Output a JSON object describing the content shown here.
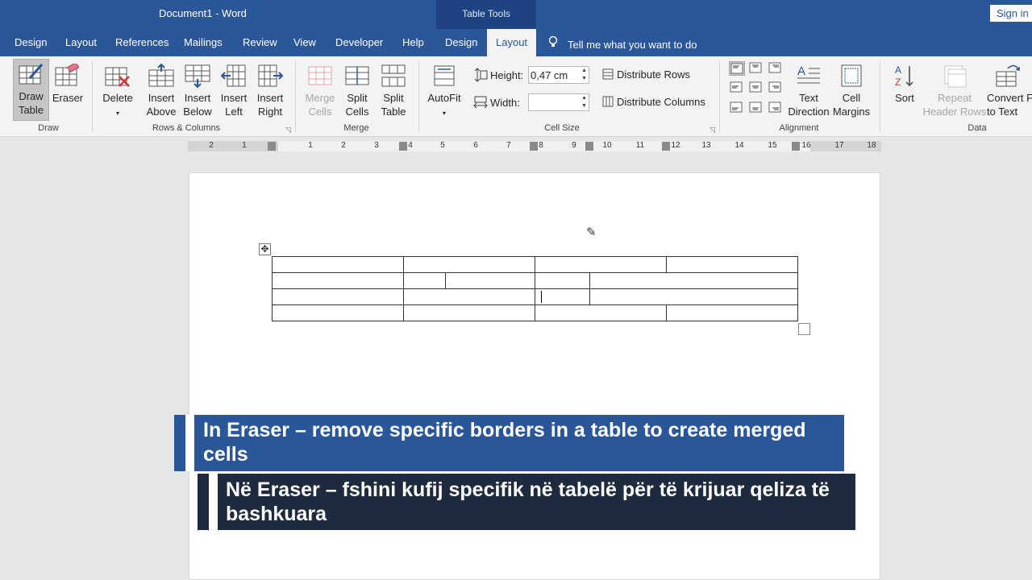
{
  "app": {
    "title": "Document1  -  Word",
    "context_group": "Table Tools",
    "signin": "Sign in"
  },
  "tabs": [
    "Design",
    "Layout",
    "References",
    "Mailings",
    "Review",
    "View",
    "Developer",
    "Help",
    "Design",
    "Layout"
  ],
  "tell_me": "Tell me what you want to do",
  "ribbon": {
    "draw": {
      "label": "Draw",
      "draw_table_l1": "Draw",
      "draw_table_l2": "Table",
      "eraser": "Eraser"
    },
    "rows_columns": {
      "label": "Rows & Columns",
      "delete": "Delete",
      "insert_above_l1": "Insert",
      "insert_above_l2": "Above",
      "insert_below_l1": "Insert",
      "insert_below_l2": "Below",
      "insert_left_l1": "Insert",
      "insert_left_l2": "Left",
      "insert_right_l1": "Insert",
      "insert_right_l2": "Right"
    },
    "merge": {
      "label": "Merge",
      "merge_cells_l1": "Merge",
      "merge_cells_l2": "Cells",
      "split_cells_l1": "Split",
      "split_cells_l2": "Cells",
      "split_table_l1": "Split",
      "split_table_l2": "Table"
    },
    "cell_size": {
      "label": "Cell Size",
      "autofit": "AutoFit",
      "height_label": "Height:",
      "height_value": "0,47 cm",
      "width_label": "Width:",
      "width_value": "",
      "distribute_rows": "Distribute Rows",
      "distribute_columns": "Distribute Columns"
    },
    "alignment": {
      "label": "Alignment",
      "text_direction_l1": "Text",
      "text_direction_l2": "Direction",
      "cell_margins_l1": "Cell",
      "cell_margins_l2": "Margins"
    },
    "data": {
      "label": "Data",
      "sort": "Sort",
      "repeat_header_l1": "Repeat",
      "repeat_header_l2": "Header Rows",
      "convert_l1": "Convert F",
      "convert_l2": "to Text"
    }
  },
  "ruler": {
    "labels": [
      "2",
      "1",
      "1",
      "2",
      "3",
      "4",
      "5",
      "6",
      "7",
      "8",
      "9",
      "10",
      "11",
      "12",
      "13",
      "14",
      "15",
      "16",
      "17",
      "18"
    ]
  },
  "captions": {
    "english": "In Eraser – remove specific borders in a table to create merged cells",
    "albanian": "Në Eraser – fshini kufij specifik në tabelë për të krijuar qeliza të bashkuara"
  },
  "colors": {
    "word_blue": "#2b579a",
    "table_tools_dark": "#1d4382",
    "caption_dark": "#1e2b3e"
  }
}
